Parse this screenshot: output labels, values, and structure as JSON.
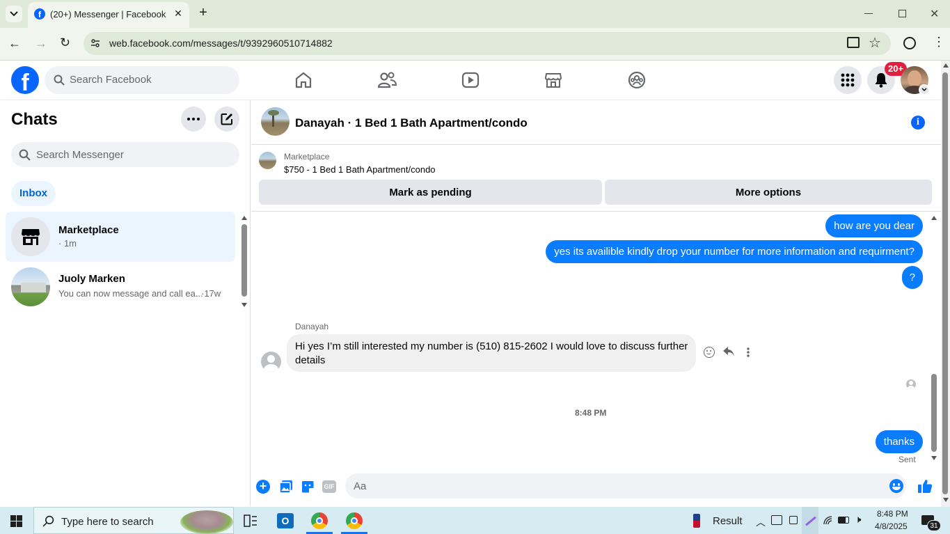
{
  "browser": {
    "tab_title": "(20+) Messenger | Facebook",
    "url": "web.facebook.com/messages/t/9392960510714882"
  },
  "fb": {
    "search_placeholder": "Search Facebook",
    "notif_badge": "20+"
  },
  "sidebar": {
    "title": "Chats",
    "search_placeholder": "Search Messenger",
    "filter_inbox": "Inbox",
    "chats": [
      {
        "name": "Marketplace",
        "preview": "· 1m"
      },
      {
        "name": "Juoly Marken",
        "preview": "You can now message and call ea...",
        "time": "·17w"
      }
    ]
  },
  "conversation": {
    "title": "Danayah · 1 Bed 1 Bath Apartment/condo",
    "marketplace_label": "Marketplace",
    "listing": "$750 - 1 Bed 1 Bath Apartment/condo",
    "mark_pending": "Mark as pending",
    "more_options": "More options",
    "messages": [
      {
        "text": "how are you dear"
      },
      {
        "text": "yes its availible kindly drop your number for more information and requirment?"
      },
      {
        "text": "?"
      }
    ],
    "incoming_sender": "Danayah",
    "incoming_line1": "Hi yes I’m still interested my number is (510) 815-2602 I would love to discuss further",
    "incoming_line2": "details",
    "timestamp": "8:48 PM",
    "last_message": "thanks",
    "status": "Sent",
    "composer_placeholder": "Aa",
    "gif_label": "GIF"
  },
  "taskbar": {
    "search_placeholder": "Type here to search",
    "widget_text": "Result",
    "time": "8:48 PM",
    "date": "4/8/2025",
    "notif_count": "31"
  },
  "colors": {
    "accent": "#0a7cff",
    "fb_blue": "#0866ff",
    "badge_red": "#e41e3f"
  }
}
